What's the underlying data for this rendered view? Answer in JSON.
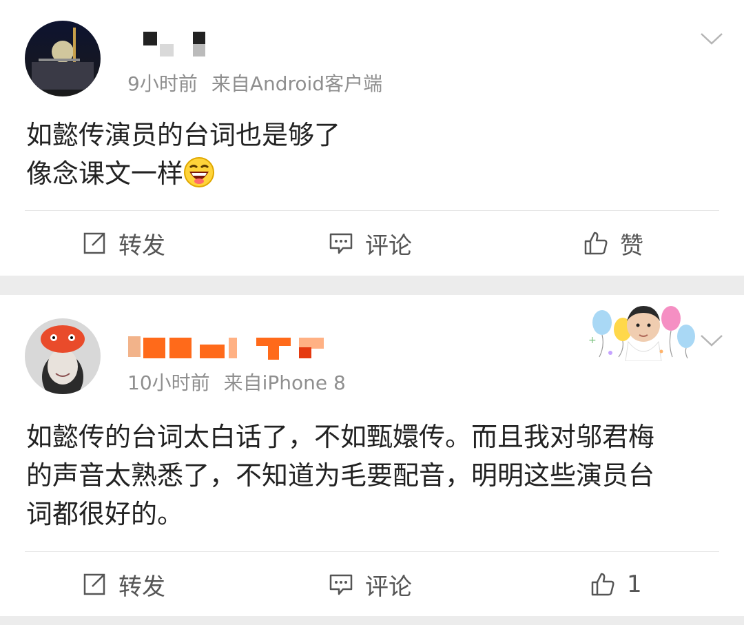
{
  "posts": [
    {
      "time": "9小时前",
      "source": "来自Android客户端",
      "text_lines": [
        "如懿传演员的台词也是够了",
        "像念课文一样"
      ],
      "emoji": "grinning-face-emoji",
      "actions": {
        "repost": "转发",
        "comment": "评论",
        "like": "赞"
      }
    },
    {
      "time": "10小时前",
      "source": "来自iPhone 8",
      "text_lines": [
        "如懿传的台词太白话了，不如甄嬛传。而且我对邬君梅",
        "的声音太熟悉了，不知道为毛要配音，明明这些演员台",
        "词都很好的。"
      ],
      "actions": {
        "repost": "转发",
        "comment": "评论",
        "like": "1"
      }
    }
  ],
  "icons": {
    "repost": "repost-icon",
    "comment": "comment-icon",
    "like": "thumbs-up-icon",
    "more": "chevron-down-icon",
    "badge": "birthday-balloons-badge"
  },
  "colors": {
    "page_bg": "#ececec",
    "card_bg": "#ffffff",
    "meta_gray": "#8f8f8f",
    "text": "#222222",
    "action_text": "#555555",
    "username_orange": "#ff6a1a"
  }
}
